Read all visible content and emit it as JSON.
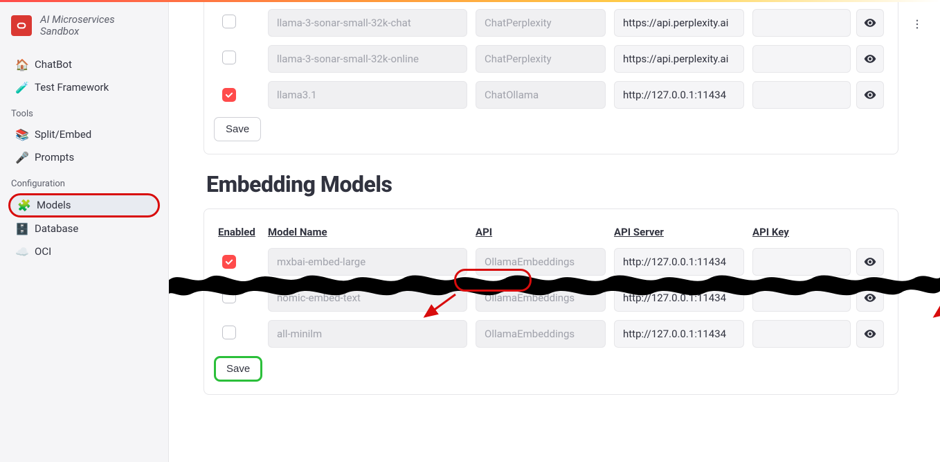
{
  "brand": {
    "line1": "AI Microservices",
    "line2": "Sandbox"
  },
  "sidebar": {
    "groups": [
      {
        "label": null,
        "items": [
          {
            "icon": "🏠",
            "label": "ChatBot",
            "name": "sidebar-item-chatbot"
          },
          {
            "icon": "🧪",
            "label": "Test Framework",
            "name": "sidebar-item-test-framework"
          }
        ]
      },
      {
        "label": "Tools",
        "items": [
          {
            "icon": "📚",
            "label": "Split/Embed",
            "name": "sidebar-item-split-embed"
          },
          {
            "icon": "🎤",
            "label": "Prompts",
            "name": "sidebar-item-prompts"
          }
        ]
      },
      {
        "label": "Configuration",
        "items": [
          {
            "icon": "�综",
            "label": "Models",
            "name": "sidebar-item-models",
            "highlighted": true
          },
          {
            "icon": "🗄️",
            "label": "Database",
            "name": "sidebar-item-database"
          },
          {
            "icon": "☁️",
            "label": "OCI",
            "name": "sidebar-item-oci"
          }
        ]
      }
    ]
  },
  "llm_table": {
    "save_label": "Save",
    "rows": [
      {
        "enabled": false,
        "name": "llama-3-sonar-small-32k-chat",
        "api": "ChatPerplexity",
        "server": "https://api.perplexity.ai"
      },
      {
        "enabled": false,
        "name": "llama-3-sonar-small-32k-online",
        "api": "ChatPerplexity",
        "server": "https://api.perplexity.ai"
      },
      {
        "enabled": true,
        "name": "llama3.1",
        "api": "ChatOllama",
        "server": "http://127.0.0.1:11434"
      }
    ]
  },
  "embed_section_title": "Embedding Models",
  "embed_table": {
    "headers": {
      "enabled": "Enabled",
      "name": "Model Name",
      "api": "API",
      "server": "API Server",
      "key": "API Key"
    },
    "save_label": "Save",
    "rows": [
      {
        "enabled": true,
        "name": "mxbai-embed-large",
        "api": "OllamaEmbeddings",
        "server": "http://127.0.0.1:11434"
      },
      {
        "enabled": false,
        "name": "nomic-embed-text",
        "api": "OllamaEmbeddings",
        "server": "http://127.0.0.1:11434"
      },
      {
        "enabled": false,
        "name": "all-minilm",
        "api": "OllamaEmbeddings",
        "server": "http://127.0.0.1:11434"
      }
    ]
  },
  "icons": {
    "models_emoji": "🧩"
  }
}
